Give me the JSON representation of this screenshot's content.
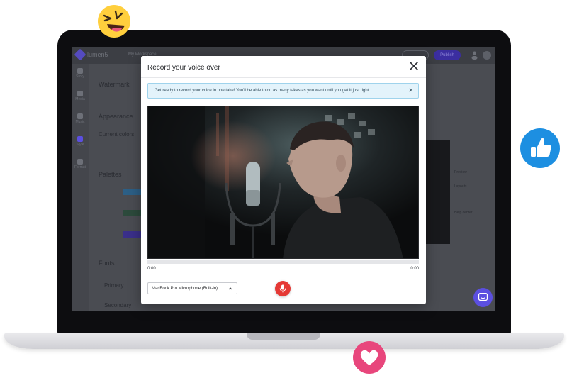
{
  "app": {
    "brand": "lumen5",
    "project": "My Workspace",
    "publish_label": "Publish",
    "sidebar": [
      {
        "label": "Story",
        "active": false
      },
      {
        "label": "Media",
        "active": false
      },
      {
        "label": "Music",
        "active": false
      },
      {
        "label": "Style",
        "active": true
      },
      {
        "label": "Format",
        "active": false
      }
    ],
    "panel": {
      "watermark_label": "Watermark",
      "appearance_label": "Appearance",
      "current_colors_label": "Current colors",
      "palettes_label": "Palettes",
      "fonts_label": "Fonts",
      "primary_label": "Primary",
      "secondary_label": "Secondary"
    },
    "right_options": [
      "Preview",
      "Layouts",
      "Help center"
    ]
  },
  "modal": {
    "title": "Record your voice over",
    "notice": "Get ready to record your voice in one take! You'll be able to do as many takes as you want until you get it just right.",
    "time_start": "0:00",
    "time_end": "0:00",
    "progress": 0,
    "microphone": "MacBook Pro Microphone (Built-in)",
    "record_icon": "microphone-icon",
    "close_icon": "close-icon"
  },
  "colors": {
    "accent": "#5b4fe0",
    "record": "#e53935",
    "notice_bg": "#e3f3fb",
    "heart": "#e8467c",
    "thumbs": "#1d8fe1",
    "emoji": "#ffcf3d"
  },
  "decor": {
    "emoji_icon": "laughing-emoji-icon",
    "thumbs_icon": "thumbs-up-icon",
    "heart_icon": "heart-icon",
    "chat_icon": "chat-icon"
  }
}
